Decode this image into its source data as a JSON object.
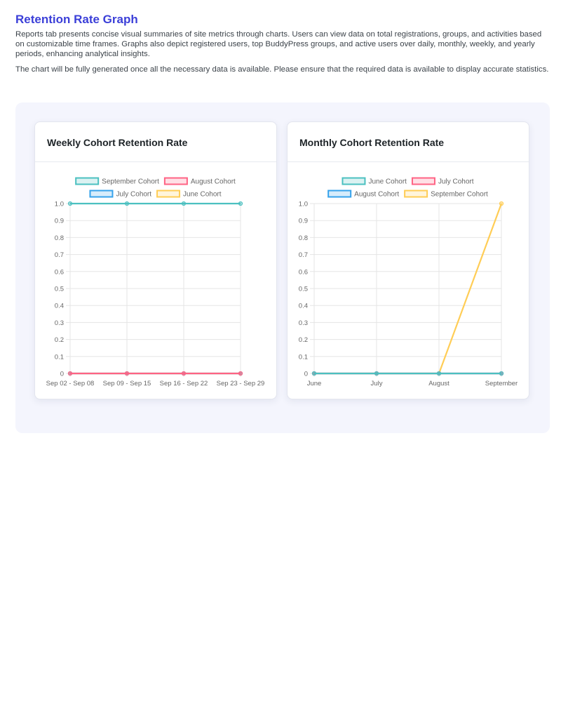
{
  "header": {
    "title": "Retention Rate Graph",
    "description": "Reports tab presents concise visual summaries of site metrics through charts. Users can view data on total registrations, groups, and activities based on customizable time frames. Graphs also depict registered users, top BuddyPress groups, and active users over daily, monthly, weekly, and yearly periods, enhancing analytical insights.",
    "notice": "The chart will be fully generated once all the necessary data is available. Please ensure that the required data is available to display accurate statistics."
  },
  "colors": {
    "teal": "#4bc0c0",
    "pink": "#ff6384",
    "blue": "#36a2eb",
    "yellow": "#ffcd56"
  },
  "chart_data": [
    {
      "type": "line",
      "title": "Weekly Cohort Retention Rate",
      "categories": [
        "Sep 02 - Sep 08",
        "Sep 09 - Sep 15",
        "Sep 16 - Sep 22",
        "Sep 23 - Sep 29"
      ],
      "ylim": [
        0,
        1
      ],
      "yticks": [
        "0",
        "0.1",
        "0.2",
        "0.3",
        "0.4",
        "0.5",
        "0.6",
        "0.7",
        "0.8",
        "0.9",
        "1.0"
      ],
      "legend_position": "top",
      "grid": true,
      "series": [
        {
          "name": "September Cohort",
          "color": "#4bc0c0",
          "values": [
            1,
            1,
            1,
            1
          ]
        },
        {
          "name": "August Cohort",
          "color": "#ff6384",
          "values": [
            0,
            0,
            0,
            0
          ]
        },
        {
          "name": "July Cohort",
          "color": "#36a2eb",
          "values": [
            0,
            0,
            0,
            0
          ]
        },
        {
          "name": "June Cohort",
          "color": "#ffcd56",
          "values": [
            0,
            0,
            0,
            0
          ]
        }
      ]
    },
    {
      "type": "line",
      "title": "Monthly Cohort Retention Rate",
      "categories": [
        "June",
        "July",
        "August",
        "September"
      ],
      "ylim": [
        0,
        1
      ],
      "yticks": [
        "0",
        "0.1",
        "0.2",
        "0.3",
        "0.4",
        "0.5",
        "0.6",
        "0.7",
        "0.8",
        "0.9",
        "1.0"
      ],
      "legend_position": "top",
      "grid": true,
      "series": [
        {
          "name": "June Cohort",
          "color": "#4bc0c0",
          "values": [
            0,
            0,
            0,
            0
          ]
        },
        {
          "name": "July Cohort",
          "color": "#ff6384",
          "values": [
            0,
            0,
            0,
            0
          ]
        },
        {
          "name": "August Cohort",
          "color": "#36a2eb",
          "values": [
            0,
            0,
            0,
            0
          ]
        },
        {
          "name": "September Cohort",
          "color": "#ffcd56",
          "values": [
            0,
            0,
            0,
            1
          ]
        }
      ]
    }
  ]
}
